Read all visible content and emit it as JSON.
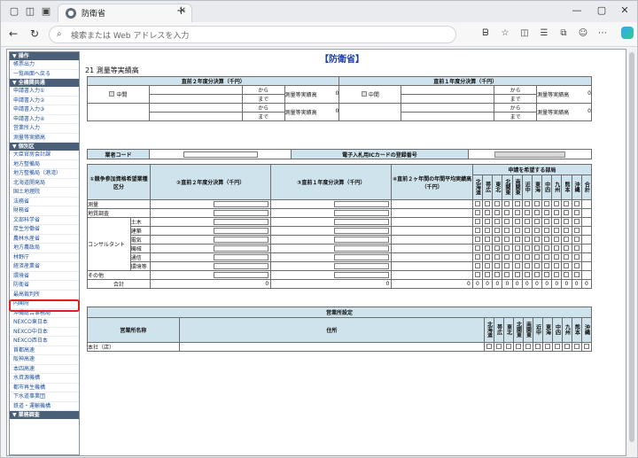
{
  "browser": {
    "tab_title": "防衛省",
    "address_placeholder": "検索または Web アドレスを入力"
  },
  "sidebar": {
    "sections": [
      {
        "title": "▼ 操作",
        "items": [
          "帳票出力",
          "一覧画面へ戻る"
        ]
      },
      {
        "title": "▼ 全機関共通",
        "items": [
          "申請書入力①",
          "申請書入力②",
          "申請書入力③",
          "申請書入力④",
          "営業所入力",
          "測量等実績高"
        ]
      },
      {
        "title": "▼ 個別区",
        "items": [
          "大臣官房会計課",
          "地方整備局",
          "地方整備局（港湾）",
          "北海道開発局",
          "国土地理院",
          "法務省",
          "財務省",
          "文部科学省",
          "厚生労働省",
          "農林水産省",
          "地方農政局",
          "林野庁",
          "経済産業省",
          "環境省",
          "防衛省",
          "最高裁判所",
          "内閣府",
          "沖縄総合事務局",
          "NEXCO東日本",
          "NEXCO中日本",
          "NEXCO西日本",
          "首都高速",
          "阪神高速",
          "本四高速",
          "水資源機構",
          "都市再生機構",
          "下水道事業団",
          "鉄道・運輸機構"
        ]
      },
      {
        "title": "▼ 業務調査",
        "items": []
      }
    ]
  },
  "main": {
    "page_title": "【防衛省】",
    "section_title": "21 測量等実績高",
    "summary": {
      "col2_header": "直前２年度分決算（千円）",
      "col1_header": "直前１年度分決算（千円）",
      "chuukan_label": "中間",
      "kara": "から",
      "made": "まで",
      "sokuryo_label": "測量等実績高",
      "zero": "0"
    },
    "company": {
      "gyosha_code_label": "業者コード",
      "ic_card_label": "電子入札用ICカードの登録番号"
    },
    "grid": {
      "h1": "①競争参加資格希望業種区分",
      "h2": "②直前２年度分決算（千円）",
      "h3": "③直前１年度分決算（千円）",
      "h4": "④直前２ヶ年間の年間平均実績高（千円）",
      "h5": "申請を希望する部局",
      "bukyoku": [
        "北海道",
        "帯広",
        "東北",
        "北関東",
        "南関東",
        "近中",
        "東海",
        "中四",
        "九州",
        "熊本",
        "沖縄",
        "合計"
      ],
      "rows": [
        {
          "cat": "測量",
          "sub": ""
        },
        {
          "cat": "地質調査",
          "sub": ""
        },
        {
          "cat": "コンサルタント",
          "sub": "土木"
        },
        {
          "cat": "",
          "sub": "建築"
        },
        {
          "cat": "",
          "sub": "電気"
        },
        {
          "cat": "",
          "sub": "機械"
        },
        {
          "cat": "",
          "sub": "通信"
        },
        {
          "cat": "",
          "sub": "環境等"
        },
        {
          "cat": "その他",
          "sub": ""
        }
      ],
      "total_label": "合計",
      "total_values": [
        "0",
        "0",
        "0"
      ]
    },
    "eigyosho": {
      "title": "営業所設定",
      "name_header": "営業所名称",
      "address_header": "住所",
      "areas": [
        "北海道",
        "帯広",
        "東北",
        "北関東",
        "南関東",
        "近中",
        "東海",
        "中四",
        "九州",
        "熊本",
        "沖縄"
      ],
      "row_label": "本社（店）"
    }
  }
}
